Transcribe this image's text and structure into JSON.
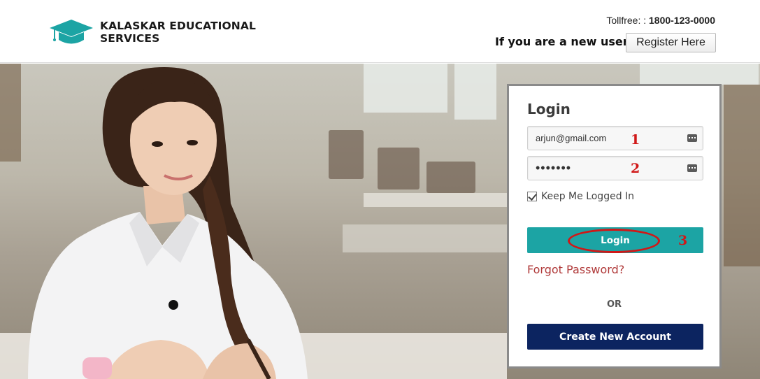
{
  "header": {
    "brand_line1": "KALASKAR EDUCATIONAL",
    "brand_line2": "SERVICES",
    "tollfree_label": "Tollfree: :",
    "tollfree_number": "1800-123-0000",
    "new_user_text": "If you are a new user!",
    "register_label": "Register Here",
    "brand_color": "#1ca4a4"
  },
  "login": {
    "title": "Login",
    "email_value": "arjun@gmail.com",
    "password_value": "•••••••",
    "keep_logged_in_label": "Keep Me Logged In",
    "keep_logged_in_checked": true,
    "login_label": "Login",
    "forgot_label": "Forgot Password?",
    "or_label": "OR",
    "create_label": "Create New Account",
    "login_color": "#1ca4a4",
    "create_color": "#0c2460"
  },
  "annotations": {
    "step1": "1",
    "step2": "2",
    "step3": "3",
    "color": "#d01818"
  }
}
